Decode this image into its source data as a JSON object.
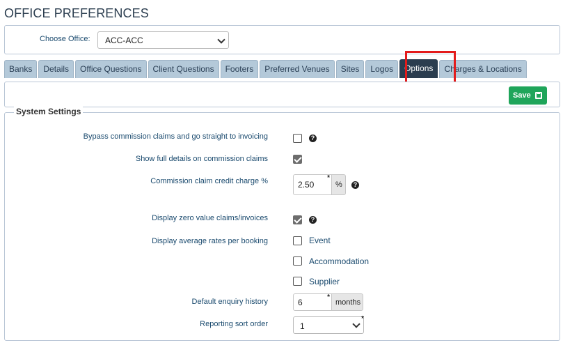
{
  "page": {
    "title": "OFFICE PREFERENCES"
  },
  "office": {
    "label": "Choose Office:",
    "selected": "ACC-ACC"
  },
  "tabs": [
    {
      "label": "Banks",
      "active": false
    },
    {
      "label": "Details",
      "active": false
    },
    {
      "label": "Office Questions",
      "active": false
    },
    {
      "label": "Client Questions",
      "active": false
    },
    {
      "label": "Footers",
      "active": false
    },
    {
      "label": "Preferred Venues",
      "active": false
    },
    {
      "label": "Sites",
      "active": false
    },
    {
      "label": "Logos",
      "active": false
    },
    {
      "label": "Options",
      "active": true
    },
    {
      "label": "Charges & Locations",
      "active": false
    }
  ],
  "toolbar": {
    "save_label": "Save"
  },
  "settings": {
    "legend": "System Settings",
    "bypass_commission": {
      "label": "Bypass commission claims and go straight to invoicing",
      "checked": false
    },
    "show_full_details": {
      "label": "Show full details on commission claims",
      "checked": true
    },
    "credit_charge": {
      "label": "Commission claim credit charge %",
      "value": "2.50",
      "unit": "%"
    },
    "zero_value": {
      "label": "Display zero value claims/invoices",
      "checked": true
    },
    "average_rates": {
      "label": "Display average rates per booking",
      "options": [
        {
          "label": "Event",
          "checked": false
        },
        {
          "label": "Accommodation",
          "checked": false
        },
        {
          "label": "Supplier",
          "checked": false
        }
      ]
    },
    "enquiry_history": {
      "label": "Default enquiry history",
      "value": "6",
      "unit": "months"
    },
    "sort_order": {
      "label": "Reporting sort order",
      "value": "1"
    }
  },
  "colors": {
    "active_tab": "#2b3d4f",
    "tab": "#b4c9d9",
    "save": "#1fa55a",
    "highlight": "#e31b1b"
  }
}
